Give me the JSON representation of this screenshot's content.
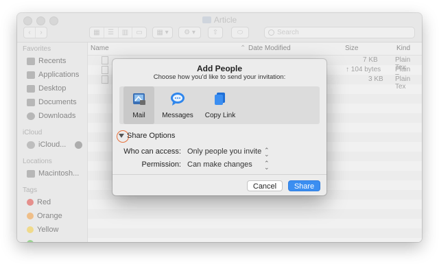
{
  "window": {
    "title": "Article",
    "search_placeholder": "Search"
  },
  "sidebar": {
    "favorites_header": "Favorites",
    "favorites": [
      "Recents",
      "Applications",
      "Desktop",
      "Documents",
      "Downloads"
    ],
    "icloud_header": "iCloud",
    "icloud": [
      "iCloud..."
    ],
    "locations_header": "Locations",
    "locations": [
      "Macintosh..."
    ],
    "tags_header": "Tags",
    "tags": [
      {
        "label": "Red",
        "color": "#e0443e"
      },
      {
        "label": "Orange",
        "color": "#f29a38"
      },
      {
        "label": "Yellow",
        "color": "#f4cd3c"
      }
    ]
  },
  "list": {
    "columns": [
      "Name",
      "Date Modified",
      "Size",
      "Kind"
    ],
    "rows": [
      {
        "size": "7 KB",
        "kind": "Plain Tex"
      },
      {
        "size": "↑ 104 bytes",
        "kind": "Plain Tex"
      },
      {
        "size": "3 KB",
        "kind": "Plain Tex"
      }
    ]
  },
  "dialog": {
    "title": "Add People",
    "subtitle": "Choose how you'd like to send your invitation:",
    "options": [
      {
        "label": "Mail",
        "icon": "mail-icon"
      },
      {
        "label": "Messages",
        "icon": "messages-icon"
      },
      {
        "label": "Copy Link",
        "icon": "copy-link-icon"
      }
    ],
    "share_options_label": "Share Options",
    "who_label": "Who can access:",
    "who_value": "Only people you invite",
    "permission_label": "Permission:",
    "permission_value": "Can make changes",
    "cancel": "Cancel",
    "share": "Share"
  },
  "colors": {
    "accent": "#3b8ef1",
    "highlight_circle": "#e8703a"
  }
}
